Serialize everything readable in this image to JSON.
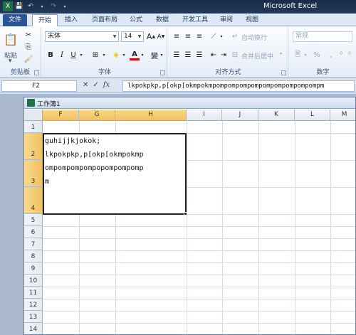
{
  "app": {
    "title": "Microsoft Excel"
  },
  "tabs": [
    "文件",
    "开始",
    "插入",
    "页面布局",
    "公式",
    "数据",
    "开发工具",
    "审阅",
    "视图"
  ],
  "ribbon": {
    "clipboard": {
      "paste": "粘贴",
      "label": "剪贴板"
    },
    "font": {
      "name": "宋体",
      "size": "14",
      "bold": "B",
      "italic": "I",
      "underline": "U",
      "color_a": "A",
      "wen": "變",
      "grow": "A",
      "shrink": "A",
      "label": "字体"
    },
    "alignment": {
      "wrap": "自动换行",
      "merge": "合并后居中",
      "label": "对齐方式"
    },
    "number": {
      "format": "常规",
      "percent": "%",
      "comma": ",",
      "label": "数字"
    }
  },
  "formula_bar": {
    "name_box": "F2",
    "fx": "fx",
    "cancel": "✕",
    "enter": "✓",
    "content": "lkpokpkp,p[okp[okmpokmpompompompompompompompompompm"
  },
  "workbook": {
    "title": "工作簿1"
  },
  "columns": [
    "F",
    "G",
    "H",
    "I",
    "J",
    "K",
    "L",
    "M"
  ],
  "rows": [
    "1",
    "2",
    "3",
    "4",
    "5",
    "6",
    "7",
    "8",
    "9",
    "10",
    "11",
    "12",
    "13",
    "14"
  ],
  "cell": {
    "lines": [
      "guhijjkjokok;",
      "lkpokpkp,p[okp[okmpokmp",
      "ompompompompopompompomp",
      "m"
    ]
  },
  "colors": {
    "accent": "#2a5699",
    "selected_header": "#f1c15f",
    "excel_green": "#1f7244"
  }
}
